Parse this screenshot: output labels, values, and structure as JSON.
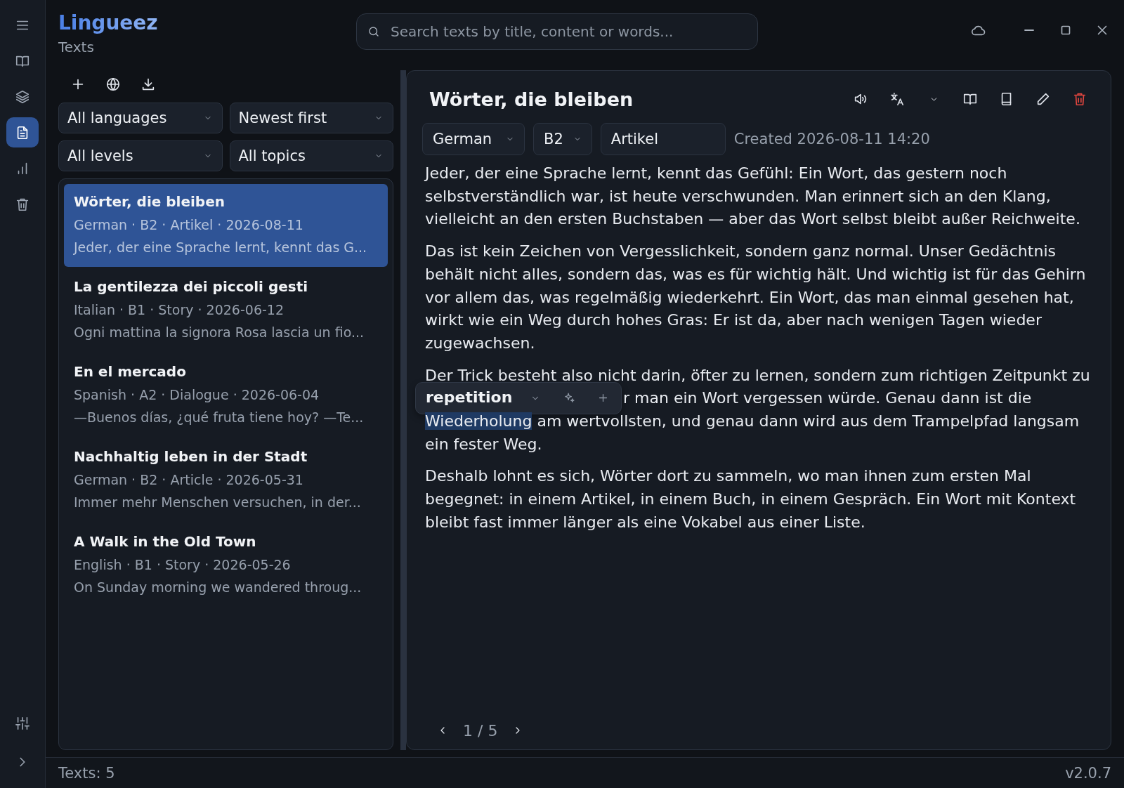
{
  "nav_rail": {
    "items": [
      {
        "kind": "menu",
        "selected": false
      },
      {
        "kind": "book",
        "selected": false
      },
      {
        "kind": "layers",
        "selected": false
      },
      {
        "kind": "document",
        "selected": true
      },
      {
        "kind": "chart",
        "selected": false
      },
      {
        "kind": "trash",
        "selected": false
      }
    ],
    "bottom_items": [
      {
        "kind": "sliders",
        "selected": false
      },
      {
        "kind": "expand",
        "selected": false
      }
    ]
  },
  "header": {
    "app_name": "Lingueez",
    "section": "Texts"
  },
  "search": {
    "placeholder": "Search texts by title, content or words..."
  },
  "filters": [
    {
      "value": "All languages"
    },
    {
      "value": "Newest first"
    },
    {
      "value": "All levels"
    },
    {
      "value": "All topics"
    }
  ],
  "texts": [
    {
      "title": "Wörter, die bleiben",
      "meta": "German · B2 · Artikel · 2026-08-11",
      "preview": "Jeder, der eine Sprache lernt, kennt das G...",
      "selected": true
    },
    {
      "title": "La gentilezza dei piccoli gesti",
      "meta": "Italian · B1 · Story · 2026-06-12",
      "preview": "Ogni mattina la signora Rosa lascia un fio...",
      "selected": false
    },
    {
      "title": "En el mercado",
      "meta": "Spanish · A2 · Dialogue · 2026-06-04",
      "preview": "—Buenos días, ¿qué fruta tiene hoy? —Te...",
      "selected": false
    },
    {
      "title": "Nachhaltig leben in der Stadt",
      "meta": "German · B2 · Article · 2026-05-31",
      "preview": "Immer mehr Menschen versuchen, in der...",
      "selected": false
    },
    {
      "title": "A Walk in the Old Town",
      "meta": "English · B1 · Story · 2026-05-26",
      "preview": "On Sunday morning we wandered throug...",
      "selected": false
    }
  ],
  "reader": {
    "title": "Wörter, die bleiben",
    "language": "German",
    "level": "B2",
    "topic": "Artikel",
    "created": "Created 2026-08-11 14:20",
    "paragraphs": [
      {
        "kind": "plain",
        "text": "Jeder, der eine Sprache lernt, kennt das Gefühl: Ein Wort, das gestern noch selbstverständlich war, ist heute verschwunden. Man erinnert sich an den Klang, vielleicht an den ersten Buchstaben — aber das Wort selbst bleibt außer Reichweite."
      },
      {
        "kind": "plain",
        "text": "Das ist kein Zeichen von Vergesslichkeit, sondern ganz normal. Unser Gedächtnis behält nicht alles, sondern das, was es für wichtig hält. Und wichtig ist für das Gehirn vor allem das, was regelmäßig wiederkehrt. Ein Wort, das man einmal gesehen hat, wirkt wie ein Weg durch hohes Gras: Er ist da, aber nach wenigen Tagen wieder zugewachsen."
      },
      {
        "kind": "annotated",
        "first_line": "Der Trick besteht also nicht darin, öfter zu lernen, sondern zum richtigen Zeitpunkt zu",
        "after_popup": "r man ein Wort vergessen würde. Genau dann ist die",
        "highlight": "Wiederholung",
        "after": "am wertvollsten, und genau dann wird aus dem Trampelpfad langsam ein fester Weg."
      },
      {
        "kind": "plain",
        "text": "Deshalb lohnt es sich, Wörter dort zu sammeln, wo man ihnen zum ersten Mal begegnet: in einem Artikel, in einem Buch, in einem Gespräch. Ein Wort mit Kontext bleibt fast immer länger als eine Vokabel aus einer Liste."
      }
    ],
    "popup": {
      "word": "repetition"
    },
    "page": "1 / 5"
  },
  "status_bar": {
    "count": "Texts: 5",
    "version": "v2.0.7"
  }
}
